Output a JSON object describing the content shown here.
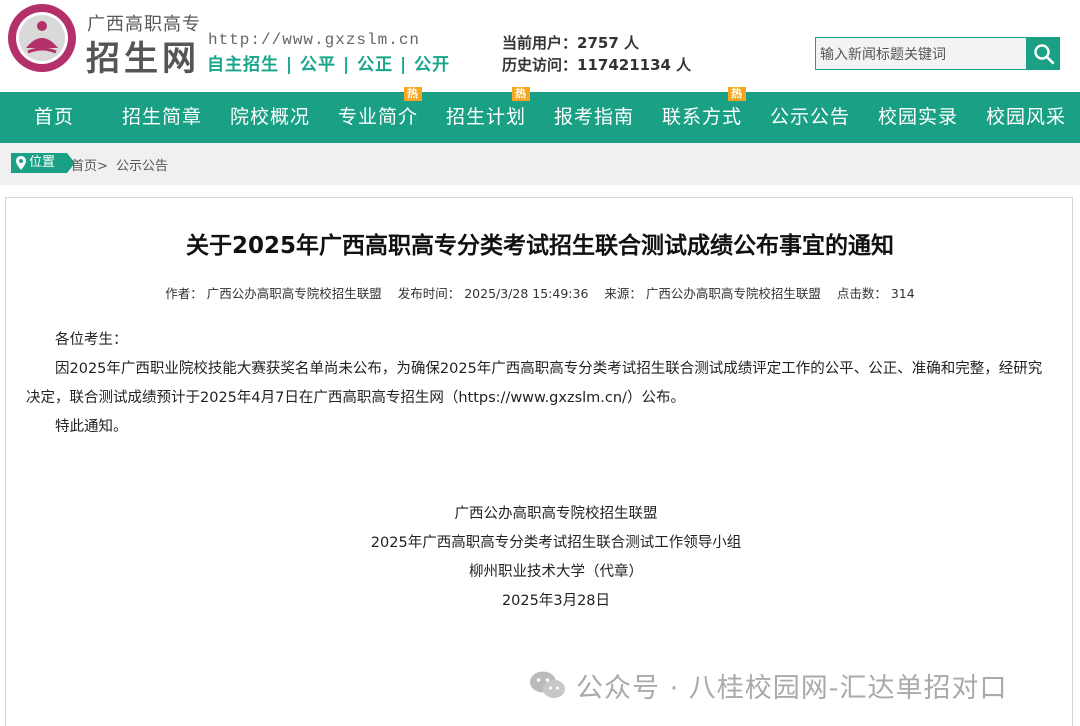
{
  "header": {
    "site_sub": "广西高职高专",
    "site_name": "招生网",
    "url": "http://www.gxzslm.cn",
    "slogan": "自主招生 | 公平 | 公正 | 公开",
    "current_users_label": "当前用户：",
    "current_users_value": "2757 人",
    "history_visits_label": "历史访问：",
    "history_visits_value": "117421134 人",
    "search_placeholder": "输入新闻标题关键词",
    "search_icon": "search-icon",
    "logo_icon": "school-seal-logo"
  },
  "nav": {
    "items": [
      "首页",
      "招生简章",
      "院校概况",
      "专业简介",
      "招生计划",
      "报考指南",
      "联系方式",
      "公示公告",
      "校园实录",
      "校园风采"
    ],
    "hot_label": "热"
  },
  "breadcrumb": {
    "location_label": "位置",
    "home": "首页>",
    "current": "公示公告"
  },
  "article": {
    "title": "关于2025年广西高职高专分类考试招生联合测试成绩公布事宜的通知",
    "meta": {
      "author": "作者：  广西公办高职高专院校招生联盟",
      "publish_time": "发布时间：  2025/3/28 15:49:36",
      "source": "来源：  广西公办高职高专院校招生联盟",
      "clicks": "点击数：  314"
    },
    "greeting": "各位考生：",
    "paragraph": "因2025年广西职业院校技能大赛获奖名单尚未公布，为确保2025年广西高职高专分类考试招生联合测试成绩评定工作的公平、公正、准确和完整，经研究决定，联合测试成绩预计于2025年4月7日在广西高职高专招生网（https://www.gxzslm.cn/）公布。",
    "closing": "特此通知。",
    "signature": [
      "广西公办高职高专院校招生联盟",
      "2025年广西高职高专分类考试招生联合测试工作领导小组",
      "柳州职业技术大学（代章）",
      "2025年3月28日"
    ]
  },
  "watermark": {
    "text": "公众号 · 八桂校园网-汇达单招对口",
    "icon": "wechat-icon"
  },
  "colors": {
    "accent": "#1aa085",
    "hot": "#f6a623",
    "logo": "#b3306a"
  }
}
